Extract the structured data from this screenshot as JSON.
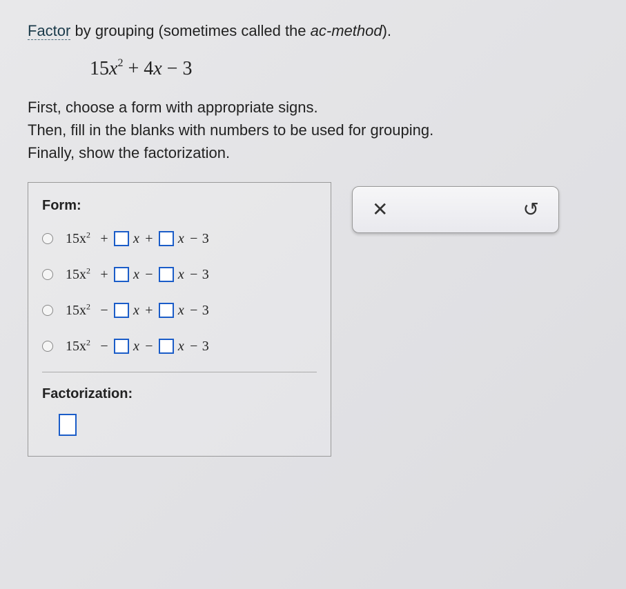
{
  "prompt": {
    "factor_link": "Factor",
    "line1_rest": " by grouping (sometimes called the ",
    "ac_method": "ac-method",
    "line1_end": ")."
  },
  "expression": {
    "coef1": "15",
    "var1": "x",
    "exp1": "2",
    "sign1": "+",
    "coef2": "4",
    "var2": "x",
    "sign2": "−",
    "const": "3"
  },
  "instructions": {
    "line1": "First, choose a form with appropriate signs.",
    "line2": "Then, fill in the blanks with numbers to be used for grouping.",
    "line3": "Finally, show the factorization."
  },
  "form": {
    "title": "Form:",
    "lead": "15x",
    "lead_exp": "2",
    "x": "x",
    "tail_sign": "−",
    "tail_const": "3",
    "options": [
      {
        "sign1": "+",
        "sign2": "+"
      },
      {
        "sign1": "+",
        "sign2": "−"
      },
      {
        "sign1": "−",
        "sign2": "+"
      },
      {
        "sign1": "−",
        "sign2": "−"
      }
    ],
    "factorization_label": "Factorization:"
  },
  "controls": {
    "close_glyph": "✕",
    "reset_glyph": "↺"
  }
}
